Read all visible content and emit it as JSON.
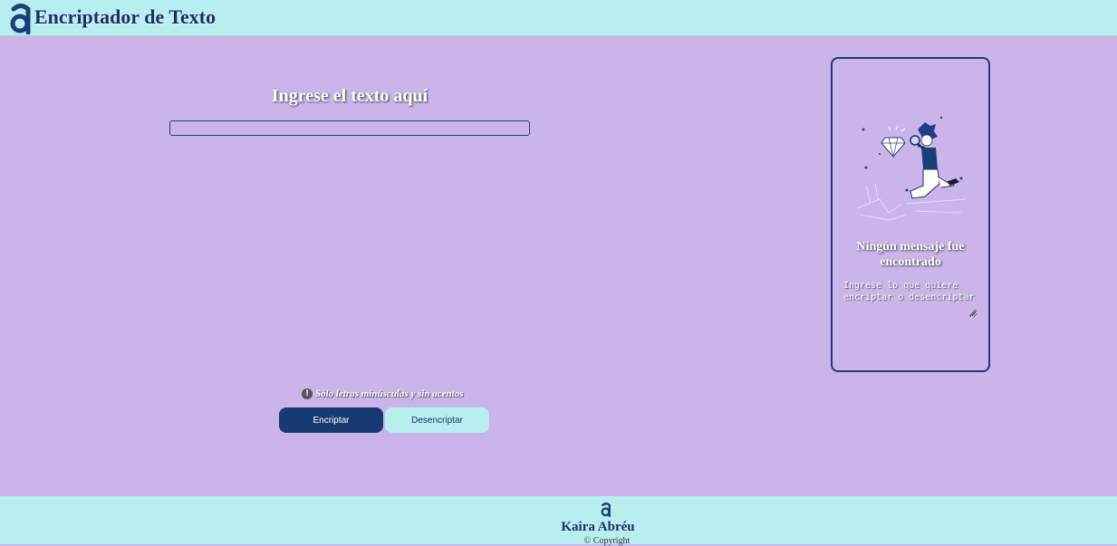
{
  "header": {
    "title": "Encriptador de Texto",
    "logo_icon": "alura-logo-icon"
  },
  "main": {
    "heading": "Ingrese el texto aquí",
    "input_value": "",
    "warning_icon": "exclamation-circle-icon",
    "warning_text": "Sólo letras minúsculas y sin acentos",
    "encrypt_label": "Encriptar",
    "decrypt_label": "Desencriptar"
  },
  "result": {
    "illustration": "person-with-magnifying-glass-and-diamond",
    "heading": "Ningún mensaje fue encontrado",
    "textarea_placeholder": "Ingrese lo que quiere encriptar o desencriptar"
  },
  "footer": {
    "logo_icon": "alura-logo-icon",
    "name": "Kaira Abréu",
    "copyright": "© Copyright"
  },
  "colors": {
    "background": "#cbb4ea",
    "header_footer": "#b8eeee",
    "primary": "#173a72",
    "secondary": "#b8eeee"
  }
}
